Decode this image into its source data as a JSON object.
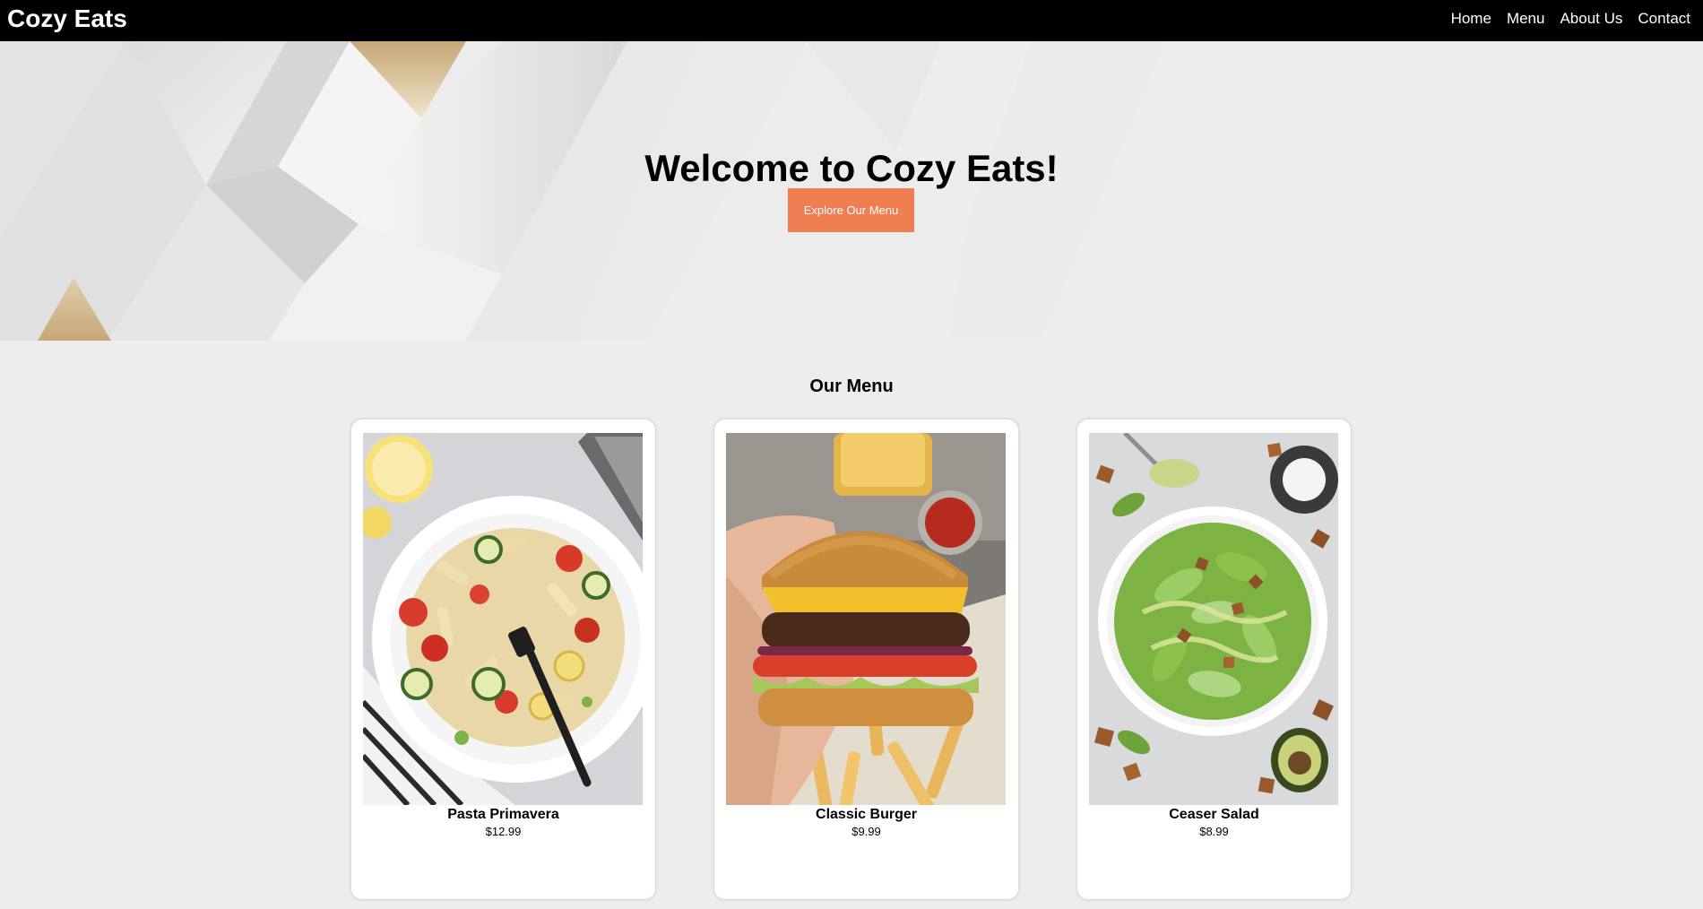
{
  "nav": {
    "brand": "Cozy Eats",
    "links": [
      "Home",
      "Menu",
      "About Us",
      "Contact"
    ]
  },
  "hero": {
    "title": "Welcome to Cozy Eats!",
    "button_label": "Explore Our Menu"
  },
  "menu": {
    "title": "Our Menu",
    "items": [
      {
        "name": "Pasta Primavera",
        "price": "$12.99"
      },
      {
        "name": "Classic Burger",
        "price": "$9.99"
      },
      {
        "name": "Ceaser Salad",
        "price": "$8.99"
      }
    ]
  },
  "colors": {
    "nav_bg": "#000000",
    "accent": "#ef7f52",
    "page_bg": "#ededed",
    "card_bg": "#ffffff"
  },
  "icons": [
    "pasta-photo",
    "burger-photo",
    "salad-photo"
  ]
}
